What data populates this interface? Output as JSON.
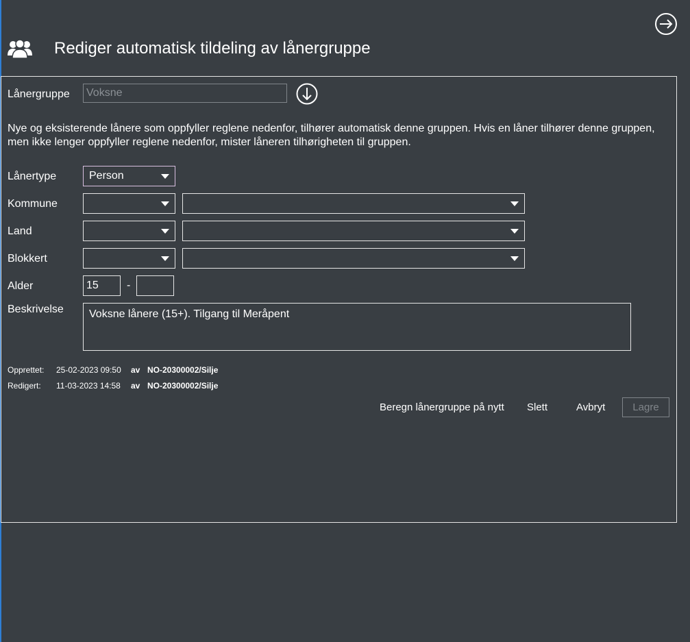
{
  "header": {
    "title": "Rediger automatisk tildeling av lånergruppe",
    "group_icon": "users-group-icon",
    "exit_icon": "arrow-right-circle-icon"
  },
  "form": {
    "lanergruppe_label": "Lånergruppe",
    "lanergruppe_value": "Voksne",
    "download_icon": "arrow-down-circle-icon",
    "info_text": "Nye og eksisterende lånere som oppfyller reglene nedenfor, tilhører automatisk denne gruppen. Hvis en låner tilhører denne gruppen, men ikke lenger oppfyller reglene nedenfor, mister låneren tilhørigheten til gruppen.",
    "lanertype_label": "Lånertype",
    "lanertype_value": "Person",
    "kommune_label": "Kommune",
    "kommune_op_value": "",
    "kommune_value": "",
    "land_label": "Land",
    "land_op_value": "",
    "land_value": "",
    "blokkert_label": "Blokkert",
    "blokkert_op_value": "",
    "blokkert_value": "",
    "alder_label": "Alder",
    "alder_from": "15",
    "alder_separator": "-",
    "alder_to": "",
    "beskrivelse_label": "Beskrivelse",
    "beskrivelse_value": "Voksne lånere (15+). Tilgang til Meråpent"
  },
  "meta": {
    "created_label": "Opprettet:",
    "created_date": "25-02-2023 09:50",
    "created_by_prefix": "av",
    "created_by": "NO-20300002/Silje",
    "edited_label": "Redigert:",
    "edited_date": "11-03-2023 14:58",
    "edited_by_prefix": "av",
    "edited_by": "NO-20300002/Silje"
  },
  "actions": {
    "recalculate": "Beregn lånergruppe på nytt",
    "delete": "Slett",
    "cancel": "Avbryt",
    "save": "Lagre"
  },
  "colors": {
    "background": "#393e43",
    "text": "#ffffff",
    "border": "#e6e6e6",
    "disabled": "#80858a",
    "accent": "#2f7fd6"
  }
}
